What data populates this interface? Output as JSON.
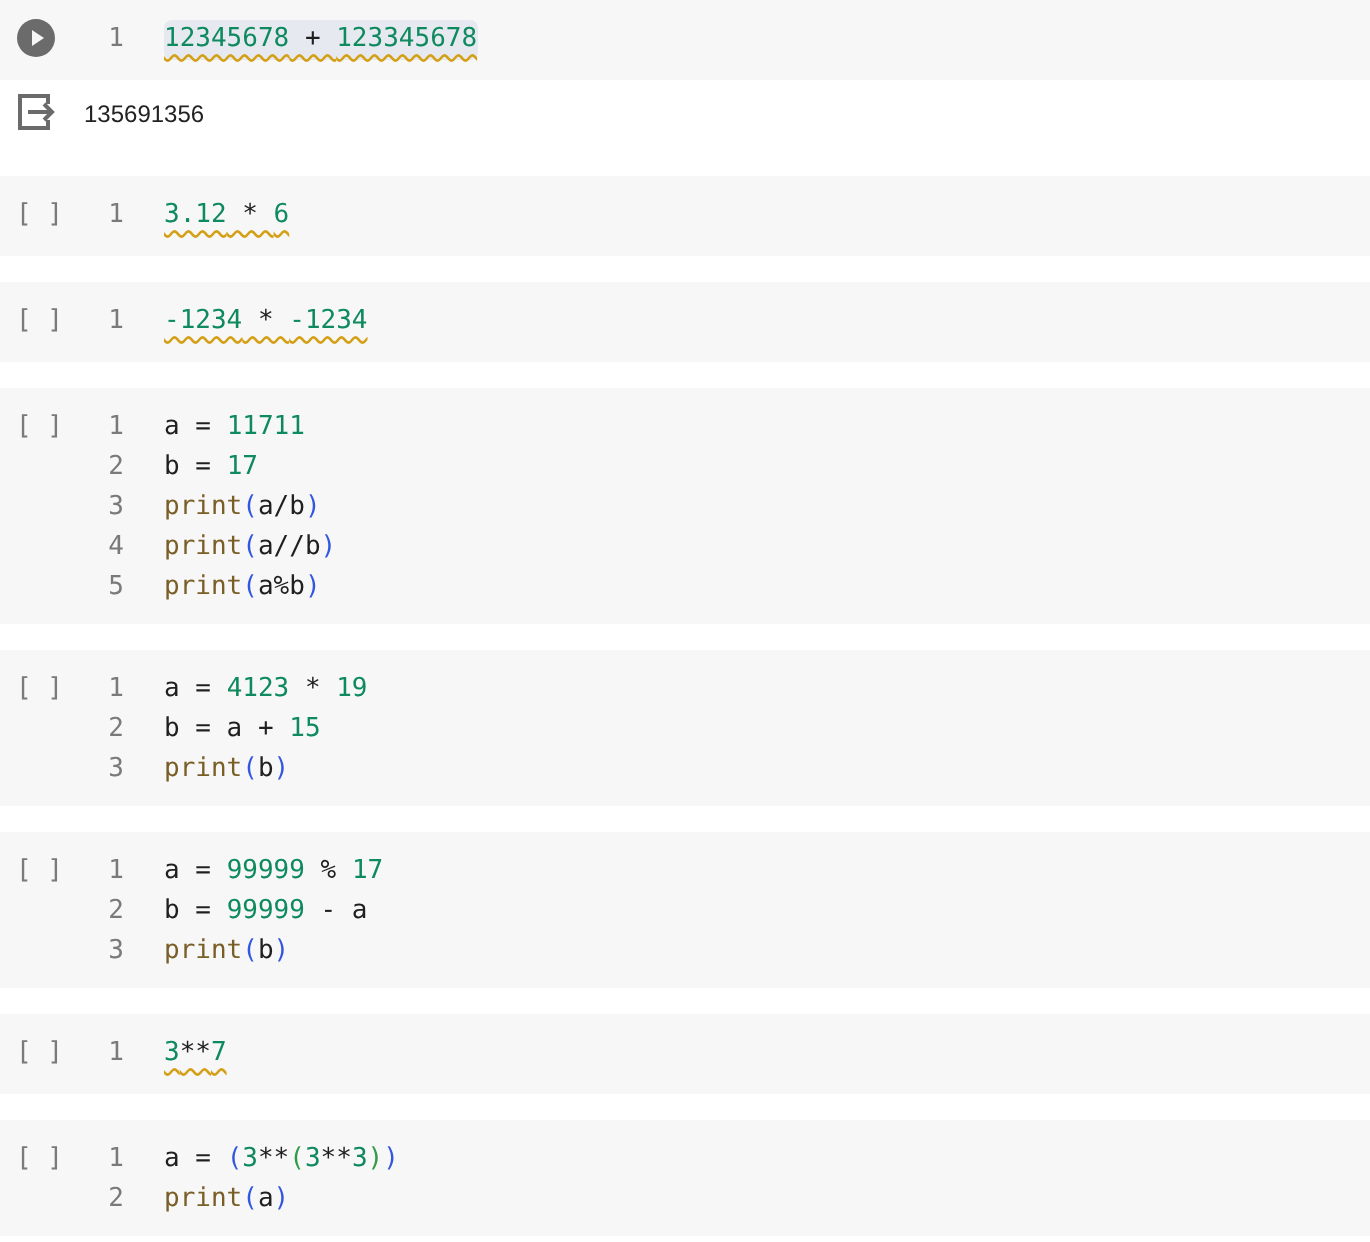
{
  "cells": [
    {
      "kind": "run",
      "highlighted": true,
      "lines": [
        {
          "number": "1",
          "warning": true,
          "tokens": [
            {
              "kind": "num",
              "t": "12345678"
            },
            {
              "kind": "plain",
              "t": " + "
            },
            {
              "kind": "num",
              "t": "123345678"
            }
          ]
        }
      ],
      "output": "135691356"
    },
    {
      "kind": "bracket",
      "marker": "[ ]",
      "highlighted": false,
      "lines": [
        {
          "number": "1",
          "warning": true,
          "tokens": [
            {
              "kind": "num",
              "t": "3.12"
            },
            {
              "kind": "plain",
              "t": " * "
            },
            {
              "kind": "num",
              "t": "6"
            }
          ]
        }
      ]
    },
    {
      "kind": "bracket",
      "marker": "[ ]",
      "highlighted": false,
      "lines": [
        {
          "number": "1",
          "warning": true,
          "tokens": [
            {
              "kind": "num",
              "t": "-1234"
            },
            {
              "kind": "plain",
              "t": " * "
            },
            {
              "kind": "num",
              "t": "-1234"
            }
          ]
        }
      ]
    },
    {
      "kind": "bracket",
      "marker": "[ ]",
      "highlighted": false,
      "lines": [
        {
          "number": "1",
          "warning": false,
          "tokens": [
            {
              "kind": "plain",
              "t": "a = "
            },
            {
              "kind": "num",
              "t": "11711"
            }
          ]
        },
        {
          "number": "2",
          "warning": false,
          "tokens": [
            {
              "kind": "plain",
              "t": "b = "
            },
            {
              "kind": "num",
              "t": "17"
            }
          ]
        },
        {
          "number": "3",
          "warning": false,
          "tokens": [
            {
              "kind": "func",
              "t": "print"
            },
            {
              "kind": "paren1",
              "t": "("
            },
            {
              "kind": "plain",
              "t": "a/b"
            },
            {
              "kind": "paren1",
              "t": ")"
            }
          ]
        },
        {
          "number": "4",
          "warning": false,
          "tokens": [
            {
              "kind": "func",
              "t": "print"
            },
            {
              "kind": "paren1",
              "t": "("
            },
            {
              "kind": "plain",
              "t": "a//b"
            },
            {
              "kind": "paren1",
              "t": ")"
            }
          ]
        },
        {
          "number": "5",
          "warning": false,
          "tokens": [
            {
              "kind": "func",
              "t": "print"
            },
            {
              "kind": "paren1",
              "t": "("
            },
            {
              "kind": "plain",
              "t": "a%b"
            },
            {
              "kind": "paren1",
              "t": ")"
            }
          ]
        }
      ]
    },
    {
      "kind": "bracket",
      "marker": "[ ]",
      "highlighted": false,
      "lines": [
        {
          "number": "1",
          "warning": false,
          "tokens": [
            {
              "kind": "plain",
              "t": "a = "
            },
            {
              "kind": "num",
              "t": "4123"
            },
            {
              "kind": "plain",
              "t": " * "
            },
            {
              "kind": "num",
              "t": "19"
            }
          ]
        },
        {
          "number": "2",
          "warning": false,
          "tokens": [
            {
              "kind": "plain",
              "t": "b = a + "
            },
            {
              "kind": "num",
              "t": "15"
            }
          ]
        },
        {
          "number": "3",
          "warning": false,
          "tokens": [
            {
              "kind": "func",
              "t": "print"
            },
            {
              "kind": "paren1",
              "t": "("
            },
            {
              "kind": "plain",
              "t": "b"
            },
            {
              "kind": "paren1",
              "t": ")"
            }
          ]
        }
      ]
    },
    {
      "kind": "bracket",
      "marker": "[ ]",
      "highlighted": false,
      "lines": [
        {
          "number": "1",
          "warning": false,
          "tokens": [
            {
              "kind": "plain",
              "t": "a = "
            },
            {
              "kind": "num",
              "t": "99999"
            },
            {
              "kind": "plain",
              "t": " % "
            },
            {
              "kind": "num",
              "t": "17"
            }
          ]
        },
        {
          "number": "2",
          "warning": false,
          "tokens": [
            {
              "kind": "plain",
              "t": "b = "
            },
            {
              "kind": "num",
              "t": "99999"
            },
            {
              "kind": "plain",
              "t": " - a"
            }
          ]
        },
        {
          "number": "3",
          "warning": false,
          "tokens": [
            {
              "kind": "func",
              "t": "print"
            },
            {
              "kind": "paren1",
              "t": "("
            },
            {
              "kind": "plain",
              "t": "b"
            },
            {
              "kind": "paren1",
              "t": ")"
            }
          ]
        }
      ]
    },
    {
      "kind": "bracket",
      "marker": "[ ]",
      "highlighted": false,
      "lines": [
        {
          "number": "1",
          "warning": true,
          "tokens": [
            {
              "kind": "num",
              "t": "3"
            },
            {
              "kind": "plain",
              "t": "**"
            },
            {
              "kind": "num",
              "t": "7"
            }
          ]
        }
      ]
    },
    {
      "kind": "bracket",
      "marker": "[ ]",
      "highlighted": false,
      "lines": [
        {
          "number": "1",
          "warning": false,
          "tokens": [
            {
              "kind": "plain",
              "t": "a = "
            },
            {
              "kind": "paren1",
              "t": "("
            },
            {
              "kind": "num",
              "t": "3"
            },
            {
              "kind": "plain",
              "t": "**"
            },
            {
              "kind": "paren2",
              "t": "("
            },
            {
              "kind": "num",
              "t": "3"
            },
            {
              "kind": "plain",
              "t": "**"
            },
            {
              "kind": "num",
              "t": "3"
            },
            {
              "kind": "paren2",
              "t": ")"
            },
            {
              "kind": "paren1",
              "t": ")"
            }
          ]
        },
        {
          "number": "2",
          "warning": false,
          "tokens": [
            {
              "kind": "func",
              "t": "print"
            },
            {
              "kind": "paren1",
              "t": "("
            },
            {
              "kind": "plain",
              "t": "a"
            },
            {
              "kind": "paren1",
              "t": ")"
            }
          ]
        }
      ]
    }
  ]
}
